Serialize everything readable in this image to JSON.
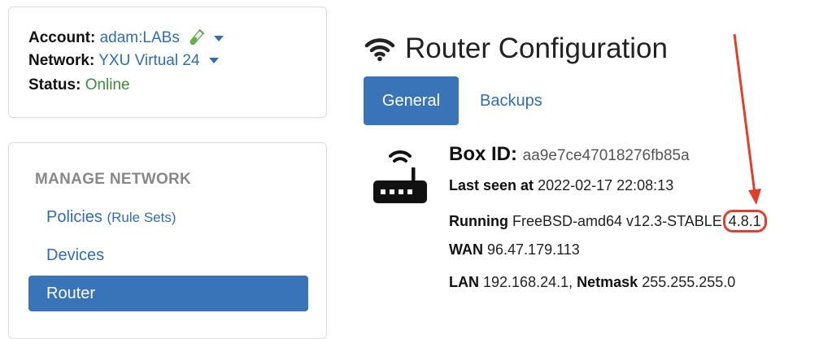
{
  "account": {
    "account_label": "Account:",
    "account_value": "adam:LABs",
    "network_label": "Network:",
    "network_value": "YXU Virtual 24",
    "status_label": "Status:",
    "status_value": "Online"
  },
  "nav": {
    "heading": "MANAGE NETWORK",
    "items": [
      {
        "label": "Policies",
        "sub": "(Rule Sets)"
      },
      {
        "label": "Devices",
        "sub": ""
      },
      {
        "label": "Router",
        "sub": ""
      }
    ]
  },
  "page": {
    "title": "Router Configuration",
    "tabs": [
      "General",
      "Backups"
    ]
  },
  "router": {
    "box_id_label": "Box ID:",
    "box_id_value": "aa9e7ce47018276fb85a",
    "last_seen_label": "Last seen at",
    "last_seen_value": "2022-02-17 22:08:13",
    "running_label": "Running",
    "running_value": "FreeBSD-amd64 v12.3-STABLE",
    "version": "4.8.1",
    "wan_label": "WAN",
    "wan_value": "96.47.179.113",
    "lan_label": "LAN",
    "lan_value": "192.168.24.1,",
    "netmask_label": "Netmask",
    "netmask_value": "255.255.255.0"
  },
  "colors": {
    "link": "#2f6db3",
    "active_bg": "#3a74b8",
    "online": "#3d8c3d",
    "annotation": "#e0402b"
  }
}
